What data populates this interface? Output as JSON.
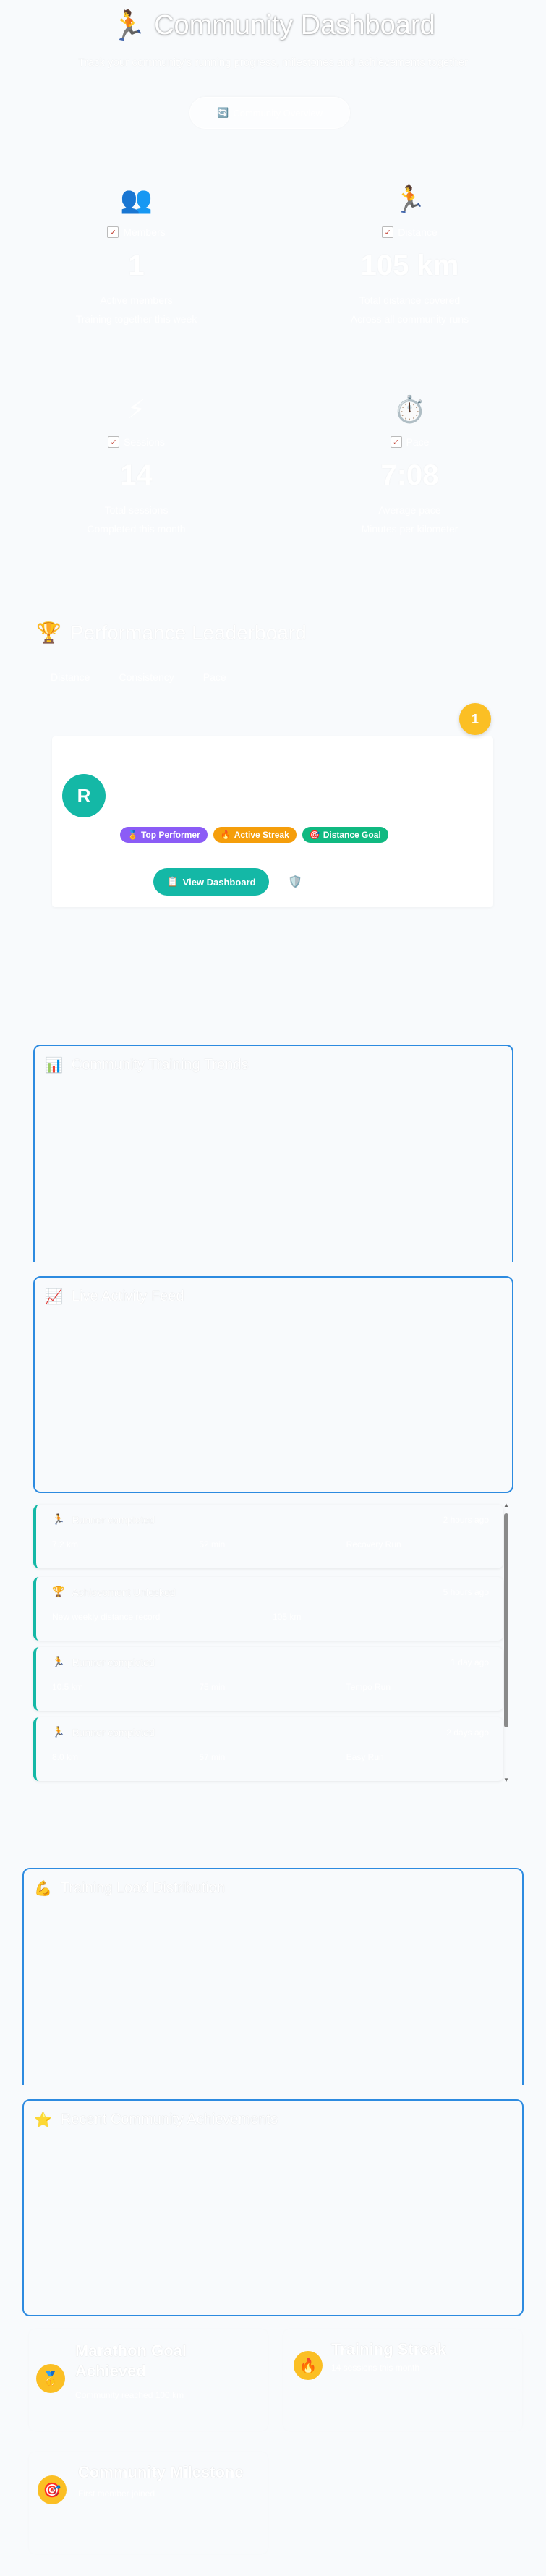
{
  "header": {
    "title": "Community Dashboard",
    "title_icon": "🏃",
    "subtitle": "Track your community's running progress, milestones and achievements together",
    "button_label": "Community Overview",
    "button_icon": "🔄"
  },
  "stats": [
    {
      "icon": "👥",
      "icon_name": "members-icon",
      "label": "Members",
      "value": "1",
      "sub1": "Active members",
      "sub2": "Training together this week"
    },
    {
      "icon": "🏃",
      "icon_name": "runner-icon",
      "label": "Distance",
      "value": "105 km",
      "sub1": "Total distance covered",
      "sub2": "Across all community runs"
    },
    {
      "icon": "⚡",
      "icon_name": "lightning-icon",
      "label": "Sessions",
      "value": "14",
      "sub1": "Total sessions",
      "sub2": "Completed this month"
    },
    {
      "icon": "⏱️",
      "icon_name": "stopwatch-icon",
      "label": "Pace",
      "value": "7:08",
      "sub1": "Average pace",
      "sub2": "Minutes per kilometer"
    }
  ],
  "leaderboard": {
    "title": "Performance Leaderboard",
    "icon": "🏆",
    "tabs": [
      "Distance",
      "Consistency",
      "Pace"
    ],
    "rank": "1",
    "avatar_letter": "R",
    "badges": [
      {
        "icon": "🏅",
        "label": "Top Performer",
        "color": "#8b5cf6"
      },
      {
        "icon": "🔥",
        "label": "Active Streak",
        "color": "#f59e0b"
      },
      {
        "icon": "🎯",
        "label": "Distance Goal",
        "color": "#10b981"
      }
    ],
    "view_button": "View Dashboard",
    "view_icon": "📋",
    "extra_icon": "🛡️"
  },
  "panels": {
    "trends_title": "Community Training Trends",
    "trends_icon": "📊",
    "feed_title": "Live Activity Feed",
    "feed_icon": "📈",
    "distribution_title": "Training Load Distribution",
    "distribution_icon": "💪",
    "achievements_title": "Recent Community Achievements",
    "achievements_icon": "⭐"
  },
  "feed": [
    {
      "icon": "🏃",
      "title": "Runner completed",
      "time": "2 hours ago",
      "meta": [
        "7.2 km",
        "52 min",
        "Recovery Run"
      ]
    },
    {
      "icon": "🏆",
      "title": "Achievement Unlocked",
      "time": "5 hours ago",
      "meta": [
        "New weekly distance record",
        "105 km",
        ""
      ]
    },
    {
      "icon": "🏃",
      "title": "Runner completed",
      "time": "1 day ago",
      "meta": [
        "10.5 km",
        "75 min",
        "Tempo Run"
      ]
    },
    {
      "icon": "🏃",
      "title": "Runner completed",
      "time": "2 days ago",
      "meta": [
        "8.0 km",
        "57 min",
        "Easy Run"
      ]
    }
  ],
  "achievements": [
    {
      "icon": "🥇",
      "title": "Marathon Goal Achieved",
      "sub": "Community reached 100 km"
    },
    {
      "icon": "🔥",
      "title": "Training Streak",
      "sub": "14 sessions this month"
    },
    {
      "icon": "🎯",
      "title": "Community Milestone",
      "sub": "First member joined"
    }
  ]
}
